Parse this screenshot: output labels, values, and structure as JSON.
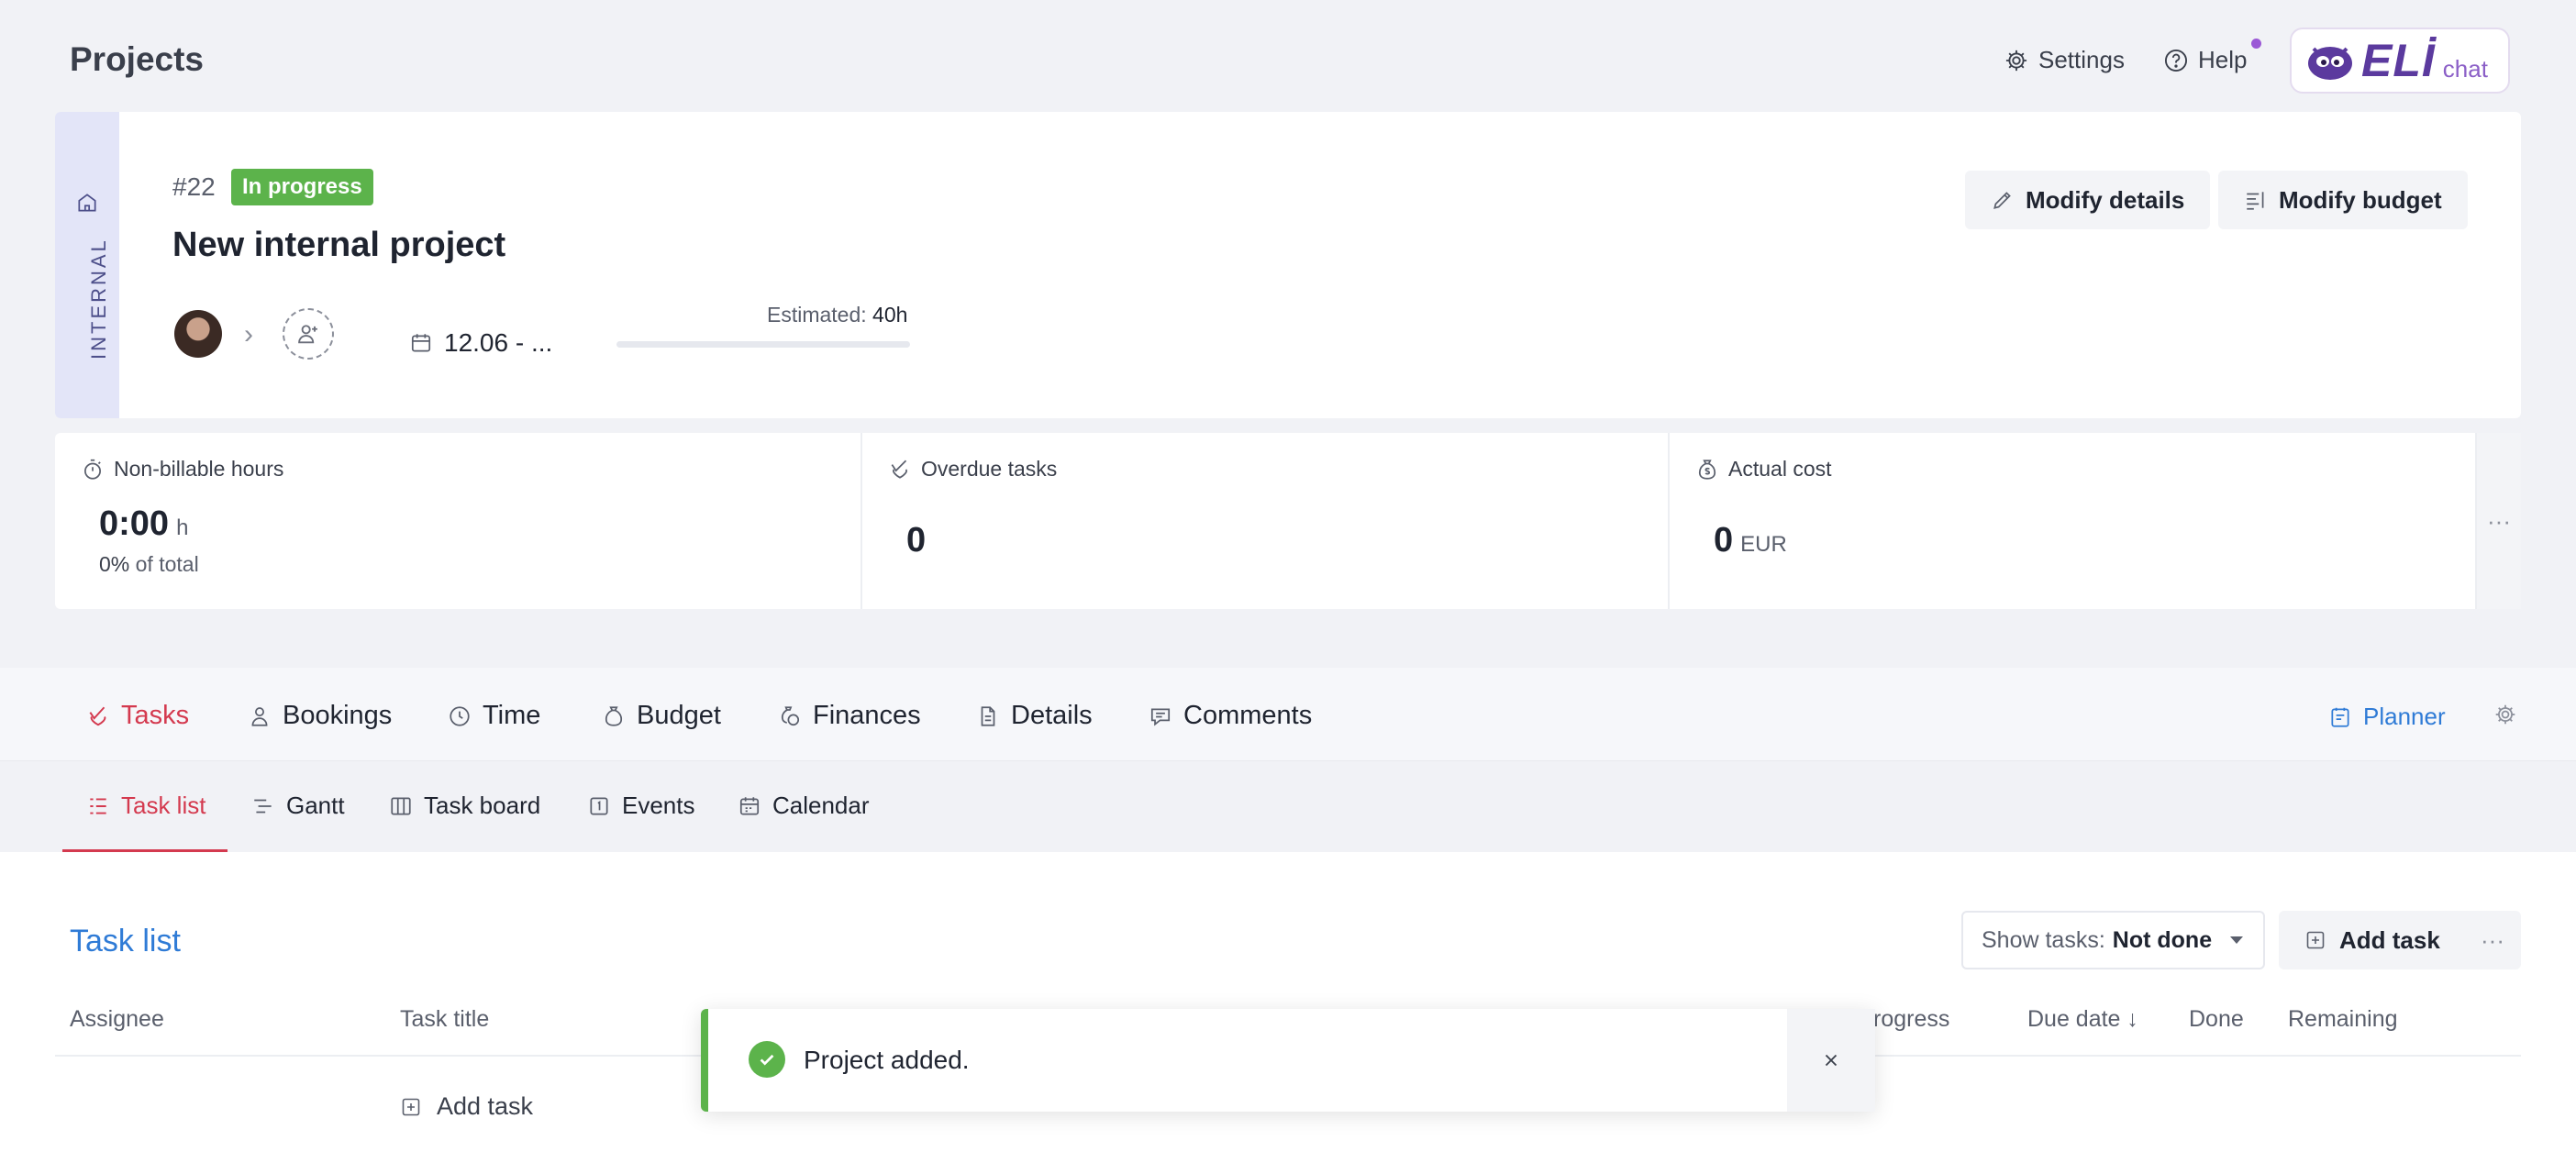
{
  "header": {
    "title": "Projects",
    "settings_label": "Settings",
    "help_label": "Help",
    "eli_brand": "ELİ",
    "eli_chat": "chat"
  },
  "project": {
    "type_label": "INTERNAL",
    "number": "#22",
    "status": "In progress",
    "name": "New internal project",
    "date_range": "12.06 - ...",
    "estimated_label": "Estimated:",
    "estimated_value": "40h",
    "estimated_progress": 0,
    "modify_details_label": "Modify details",
    "modify_budget_label": "Modify budget"
  },
  "stats": [
    {
      "label": "Non-billable hours",
      "value": "0:00",
      "unit": "h",
      "sub_value": "0%",
      "sub_text": "of total"
    },
    {
      "label": "Overdue tasks",
      "value": "0"
    },
    {
      "label": "Actual cost",
      "value": "0",
      "unit": "EUR"
    }
  ],
  "stats_more": "···",
  "tabs": [
    {
      "label": "Tasks",
      "icon": "check-heart-icon",
      "active": true
    },
    {
      "label": "Bookings",
      "icon": "person-icon"
    },
    {
      "label": "Time",
      "icon": "clock-icon"
    },
    {
      "label": "Budget",
      "icon": "money-bag-icon"
    },
    {
      "label": "Finances",
      "icon": "coins-icon"
    },
    {
      "label": "Details",
      "icon": "document-icon"
    },
    {
      "label": "Comments",
      "icon": "comment-icon"
    }
  ],
  "planner_label": "Planner",
  "subtabs": [
    {
      "label": "Task list",
      "icon": "list-icon",
      "active": true
    },
    {
      "label": "Gantt",
      "icon": "gantt-icon"
    },
    {
      "label": "Task board",
      "icon": "board-icon"
    },
    {
      "label": "Events",
      "icon": "event-icon"
    },
    {
      "label": "Calendar",
      "icon": "calendar-icon"
    }
  ],
  "tasklist": {
    "title": "Task list",
    "filter_prefix": "Show tasks:",
    "filter_value": "Not done",
    "add_task_label": "Add task",
    "more_label": "···",
    "columns": [
      "Assignee",
      "Task title",
      "rogress",
      "Due date ↓",
      "Done",
      "Remaining"
    ],
    "row_add_label": "Add task"
  },
  "toast": {
    "message": "Project added."
  },
  "colors": {
    "accent_red": "#d43a4f",
    "accent_blue": "#2f7bd6",
    "status_green": "#5cb34b",
    "internal_strip": "#e3e5f8",
    "eli_purple": "#5b3a9e"
  }
}
